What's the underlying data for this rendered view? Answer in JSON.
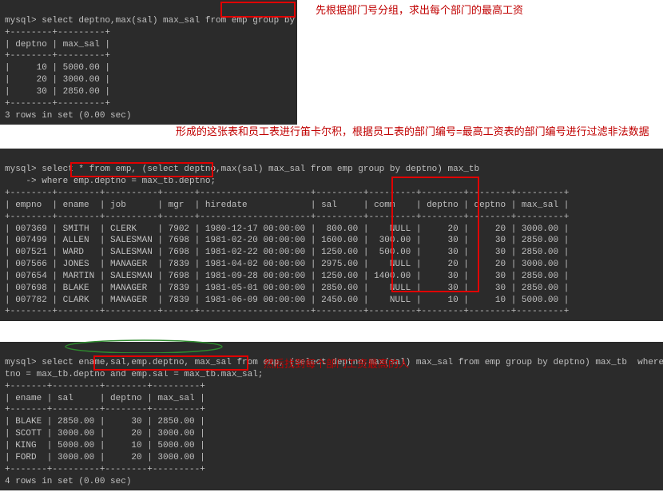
{
  "annotation1": "先根据部门号分组，求出每个部门的最高工资",
  "annotation2": "形成的这张表和员工表进行笛卡尔积，根据员工表的部门编号=最高工资表的部门编号进行过滤非法数据",
  "annotation3": "然后找到每个部门工资最高的人",
  "block1": {
    "prompt": "mysql> select deptno,max(sal) max_sal from emp group by deptno;",
    "border": "+--------+---------+",
    "header": "| deptno | max_sal |",
    "rows": [
      "|     10 | 5000.00 |",
      "|     20 | 3000.00 |",
      "|     30 | 2850.00 |"
    ],
    "footer": "3 rows in set (0.00 sec)"
  },
  "block2": {
    "line1": "mysql> select * from emp, (select deptno,max(sal) max_sal from emp group by deptno) max_tb",
    "line2": "    -> where emp.deptno = max_tb.deptno;",
    "border": "+--------+--------+----------+------+---------------------+---------+---------+--------+--------+---------+",
    "header": "| empno  | ename  | job      | mgr  | hiredate            | sal     | comm    | deptno | deptno | max_sal |",
    "rows": [
      "| 007369 | SMITH  | CLERK    | 7902 | 1980-12-17 00:00:00 |  800.00 |    NULL |     20 |     20 | 3000.00 |",
      "| 007499 | ALLEN  | SALESMAN | 7698 | 1981-02-20 00:00:00 | 1600.00 |  300.00 |     30 |     30 | 2850.00 |",
      "| 007521 | WARD   | SALESMAN | 7698 | 1981-02-22 00:00:00 | 1250.00 |  500.00 |     30 |     30 | 2850.00 |",
      "| 007566 | JONES  | MANAGER  | 7839 | 1981-04-02 00:00:00 | 2975.00 |    NULL |     20 |     20 | 3000.00 |",
      "| 007654 | MARTIN | SALESMAN | 7698 | 1981-09-28 00:00:00 | 1250.00 | 1400.00 |     30 |     30 | 2850.00 |",
      "| 007698 | BLAKE  | MANAGER  | 7839 | 1981-05-01 00:00:00 | 2850.00 |    NULL |     30 |     30 | 2850.00 |",
      "| 007782 | CLARK  | MANAGER  | 7839 | 1981-06-09 00:00:00 | 2450.00 |    NULL |     10 |     10 | 5000.00 |"
    ]
  },
  "block3": {
    "line1": "mysql> select ename,sal,emp.deptno, max_sal from emp, (select deptno,max(sal) max_sal from emp group by deptno) max_tb  where emp.dep",
    "line2": "tno = max_tb.deptno and emp.sal = max_tb.max_sal;",
    "border": "+-------+---------+--------+---------+",
    "header": "| ename | sal     | deptno | max_sal |",
    "rows": [
      "| BLAKE | 2850.00 |     30 | 2850.00 |",
      "| SCOTT | 3000.00 |     20 | 3000.00 |",
      "| KING  | 5000.00 |     10 | 5000.00 |",
      "| FORD  | 3000.00 |     20 | 3000.00 |"
    ],
    "footer": "4 rows in set (0.00 sec)"
  }
}
